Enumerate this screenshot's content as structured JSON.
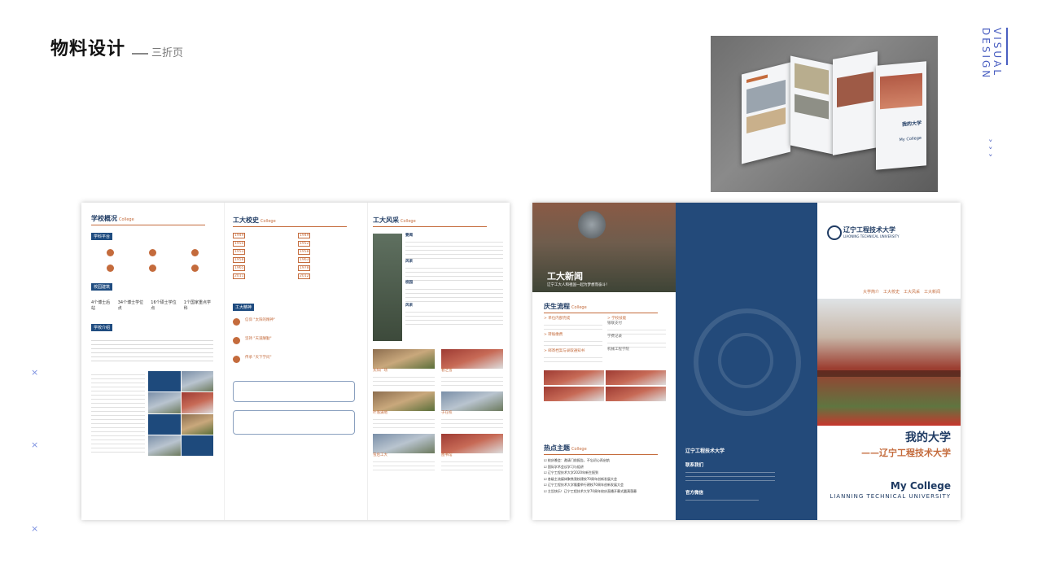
{
  "header": {
    "title": "物料设计",
    "subtitle": "三折页"
  },
  "side": {
    "vertical_text": "VISUAL DESIGN",
    "chevrons": "> > >",
    "x_mark": "×"
  },
  "left_sheet": {
    "overview": {
      "title": "学校概况",
      "en": "College",
      "tag1": "学科平台",
      "tag2": "校园建筑",
      "tag3": "学校介绍",
      "stats": [
        "4个博士后站",
        "34个博士学位点",
        "16个硕士学位点",
        "1个国家重点学科"
      ]
    },
    "history": {
      "title": "工大校史",
      "en": "College",
      "years": [
        "1949",
        "1949",
        "1950",
        "1952",
        "1953",
        "1958",
        "1958",
        "1963",
        "1965",
        "1978",
        "2011",
        "2012"
      ],
      "spirit_tag": "工大精神",
      "spirit_items": [
        "信仰 \"太阳的精神\"",
        "坚持 \"天道酬勤\"",
        "传承 \"天下学问\""
      ]
    },
    "scenery": {
      "title": "工大风采",
      "en": "College",
      "labels": [
        "要闻",
        "风采",
        "校园",
        "风采"
      ],
      "captions": [
        "太阳广场",
        "春之雪",
        "叶落满地",
        "于在校",
        "雪后工大",
        "图书馆"
      ]
    }
  },
  "right_sheet": {
    "news": {
      "banner_title": "工大新闻",
      "banner_sub": "辽宁工大人和祖国一起为梦想而奋斗！"
    },
    "enroll": {
      "title": "庆生流程",
      "en": "College",
      "items": [
        "> 单位内部完成",
        "> 转账缴费",
        "> 邮寄档案与录取通知书"
      ],
      "right_items": [
        "> 学校技能",
        "银联支付",
        "学费记录",
        "机械工程学院"
      ]
    },
    "hot": {
      "title": "热点主题",
      "en": "College",
      "items": [
        "校庆晚会：邀请门前报告，不忘初心再启航",
        "国际学术会议学习与组讲",
        "辽宁工程技术大学2020年新生报到",
        "各级主流媒体聚焦我校建校70周年创新发展大会",
        "辽宁工程技术大学隆重举行建校70周年创新发展大会",
        "主旨快乐！辽宁工程技术大学70周年校庆直播开幕式圆满落幕"
      ],
      "contact_label": "联系我们",
      "wechat_label": "官方微信"
    },
    "cover": {
      "logo_cn": "辽宁工程技术大学",
      "logo_en": "LIAONING TECHNICAL UNIVERSITY",
      "nav": [
        "大学简介",
        "工大校史",
        "工大风采",
        "工大新闻"
      ],
      "main_title": "我的大学",
      "subtitle": "——辽宁工程技术大学",
      "en_title": "My College",
      "en_sub": "LIANNING TECHNICAL UNIVERSITY"
    },
    "seal_text": "辽宁工程技术大学 · LIAONING TECHNICAL UNIVERSITY"
  },
  "colors": {
    "navy": "#234a7a",
    "accent": "#c46b3c",
    "side_blue": "#4a5fc1"
  }
}
